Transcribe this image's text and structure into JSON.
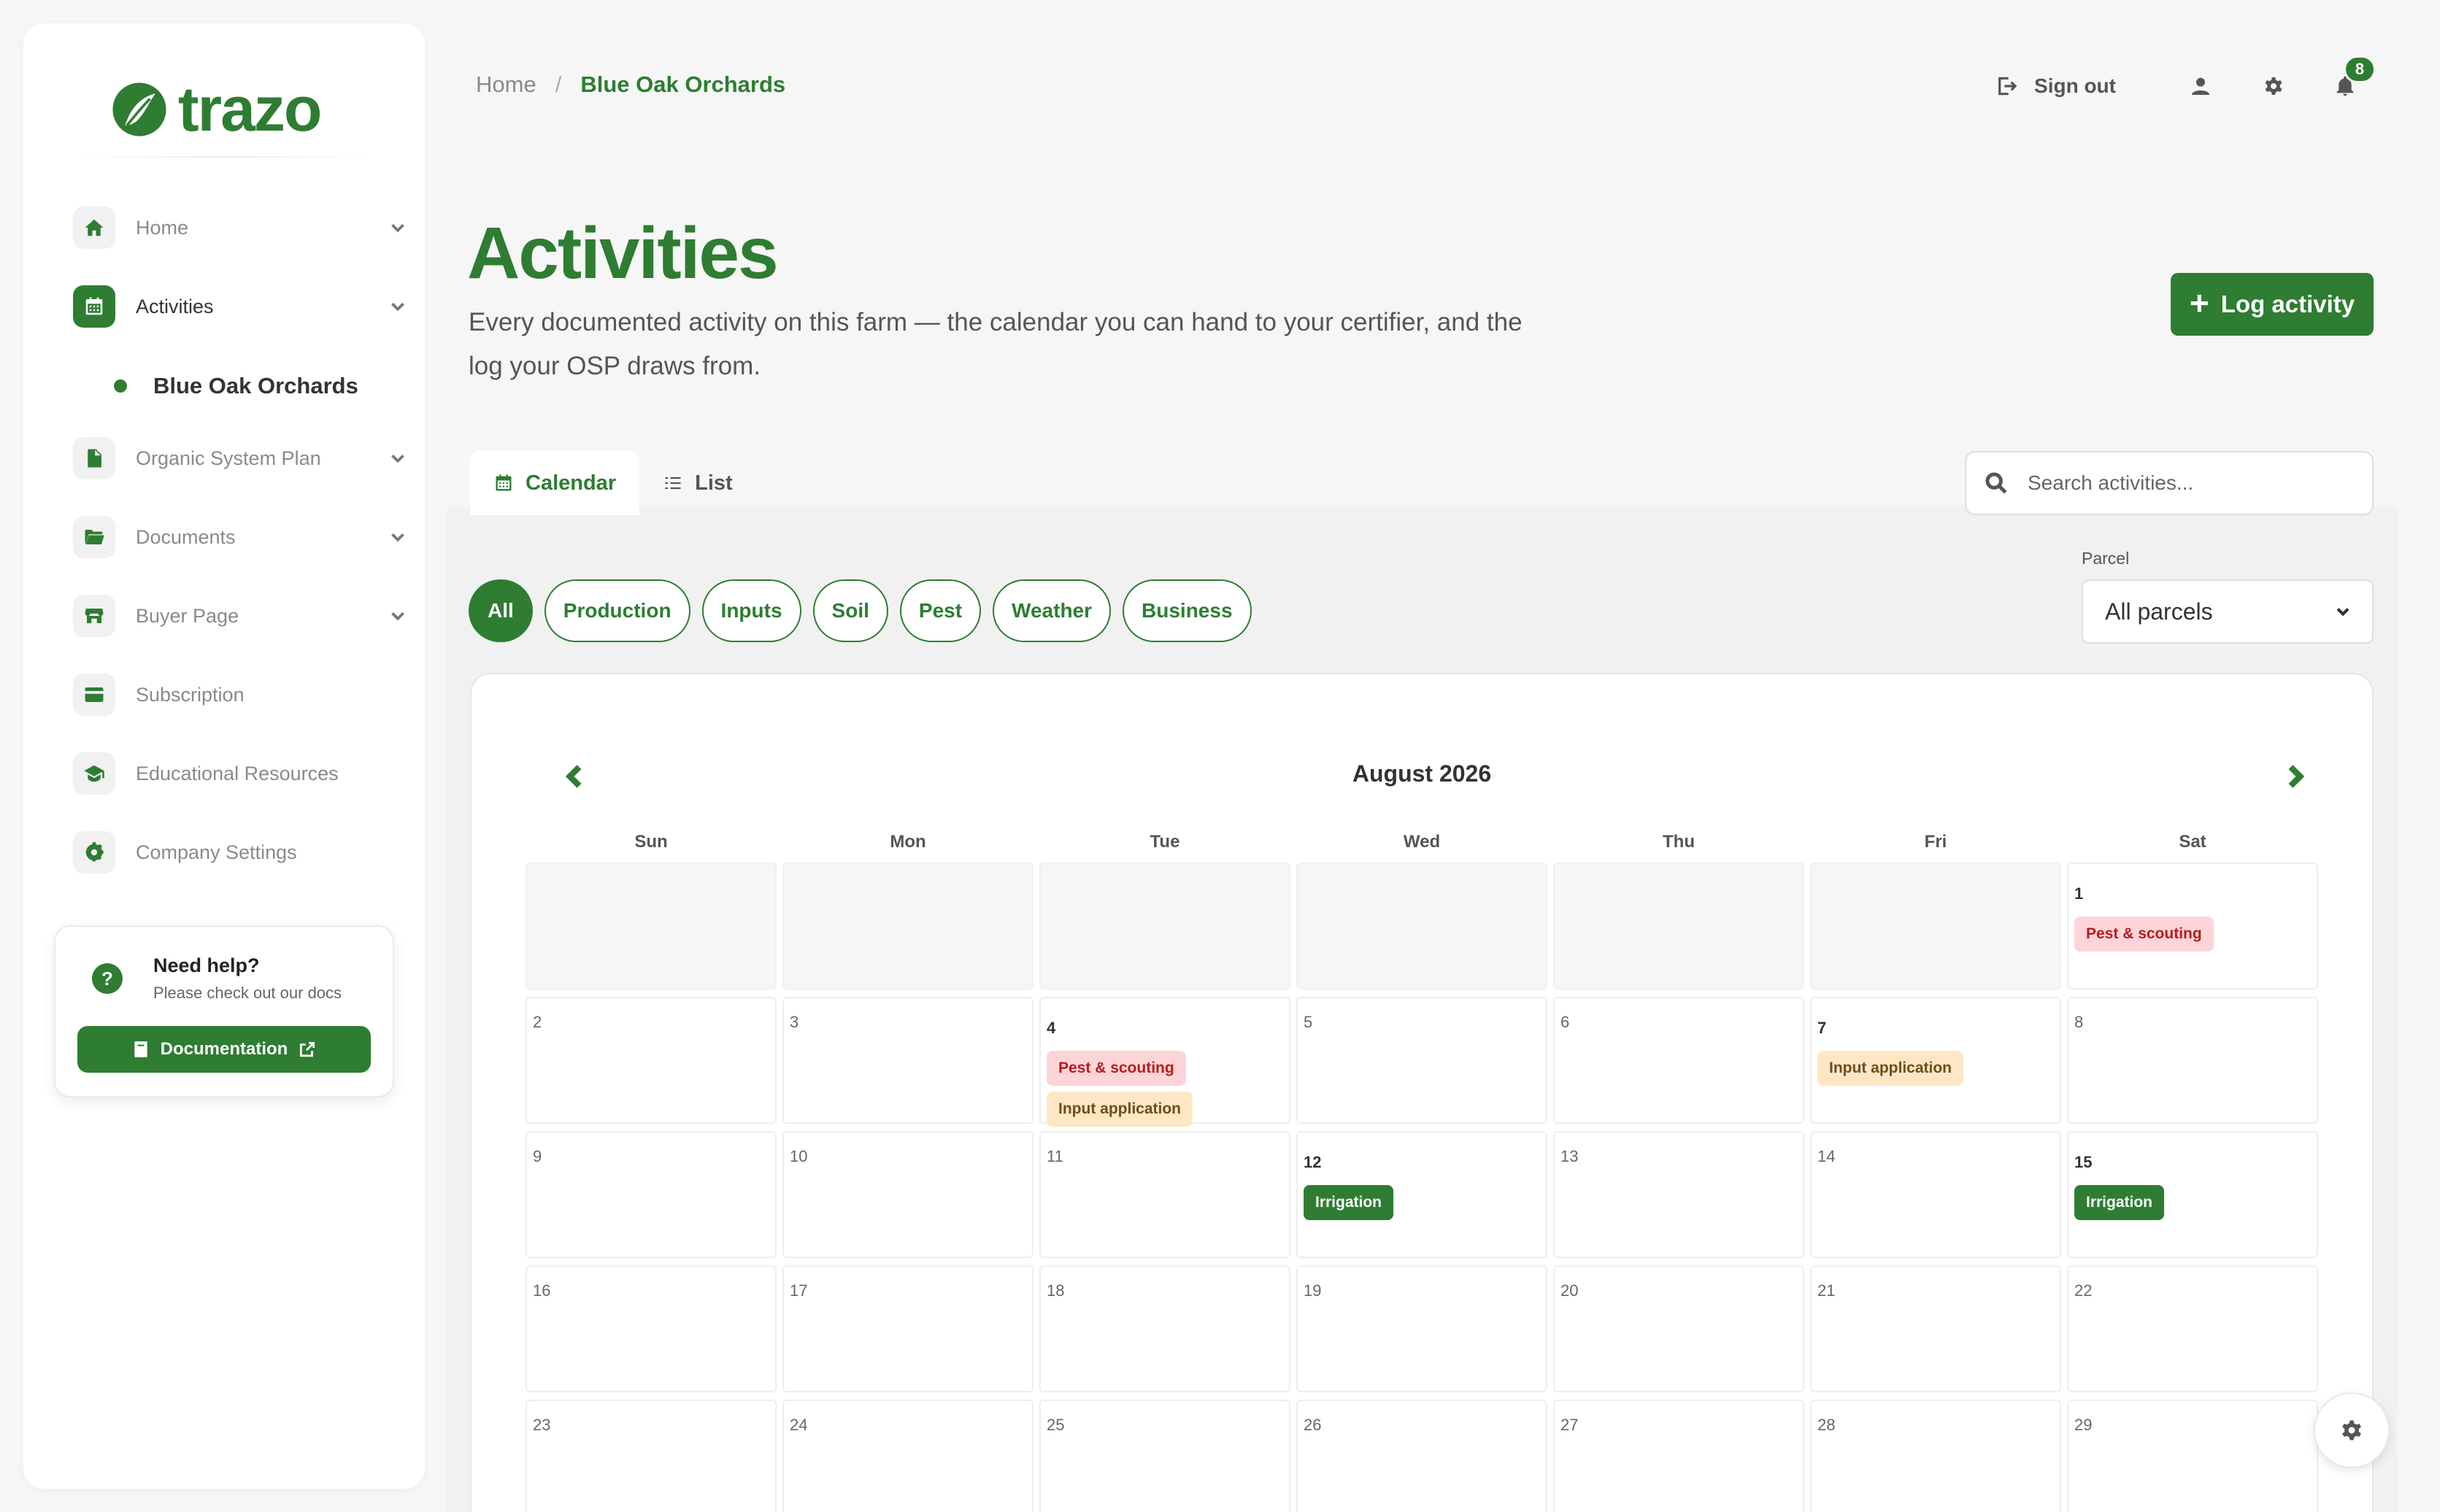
{
  "app": {
    "logo_text": "trazo",
    "brand_color": "#2e7d32"
  },
  "sidebar": {
    "items": [
      {
        "label": "Home",
        "icon": "home-icon",
        "active": false,
        "has_chevron": true
      },
      {
        "label": "Activities",
        "icon": "calendar-icon",
        "active": true,
        "has_chevron": true
      },
      {
        "label": "Organic System Plan",
        "icon": "document-icon",
        "active": false,
        "has_chevron": true
      },
      {
        "label": "Documents",
        "icon": "folder-icon",
        "active": false,
        "has_chevron": true
      },
      {
        "label": "Buyer Page",
        "icon": "store-icon",
        "active": false,
        "has_chevron": true
      },
      {
        "label": "Subscription",
        "icon": "credit-card-icon",
        "active": false,
        "has_chevron": false
      },
      {
        "label": "Educational Resources",
        "icon": "graduation-cap-icon",
        "active": false,
        "has_chevron": false
      },
      {
        "label": "Company Settings",
        "icon": "gear-icon",
        "active": false,
        "has_chevron": false
      }
    ],
    "sub_item": {
      "label": "Blue Oak Orchards"
    },
    "help": {
      "title": "Need help?",
      "subtitle": "Please check out our docs",
      "button_label": "Documentation"
    }
  },
  "header": {
    "breadcrumb": {
      "home": "Home",
      "separator": "/",
      "current": "Blue Oak Orchards"
    },
    "sign_out_label": "Sign out",
    "notification_count": "8"
  },
  "page": {
    "title": "Activities",
    "description": "Every documented activity on this farm — the calendar you can hand to your certifier, and the log your OSP draws from.",
    "log_button_label": "Log activity"
  },
  "views": {
    "tabs": [
      {
        "label": "Calendar",
        "icon": "calendar-icon",
        "active": true
      },
      {
        "label": "List",
        "icon": "list-icon",
        "active": false
      }
    ],
    "search_placeholder": "Search activities..."
  },
  "filters": {
    "chips": [
      {
        "label": "All",
        "active": true
      },
      {
        "label": "Production",
        "active": false
      },
      {
        "label": "Inputs",
        "active": false
      },
      {
        "label": "Soil",
        "active": false
      },
      {
        "label": "Pest",
        "active": false
      },
      {
        "label": "Weather",
        "active": false
      },
      {
        "label": "Business",
        "active": false
      }
    ],
    "parcel_label": "Parcel",
    "parcel_value": "All parcels"
  },
  "calendar": {
    "month_label": "August 2026",
    "weekdays": [
      "Sun",
      "Mon",
      "Tue",
      "Wed",
      "Thu",
      "Fri",
      "Sat"
    ],
    "leading_blank_days": 6,
    "days": [
      {
        "day": "1",
        "events": [
          "Pest & scouting"
        ]
      },
      {
        "day": "2",
        "events": []
      },
      {
        "day": "3",
        "events": []
      },
      {
        "day": "4",
        "events": [
          "Pest & scouting",
          "Input application"
        ]
      },
      {
        "day": "5",
        "events": []
      },
      {
        "day": "6",
        "events": []
      },
      {
        "day": "7",
        "events": [
          "Input application"
        ]
      },
      {
        "day": "8",
        "events": []
      },
      {
        "day": "9",
        "events": []
      },
      {
        "day": "10",
        "events": []
      },
      {
        "day": "11",
        "events": []
      },
      {
        "day": "12",
        "events": [
          "Irrigation"
        ]
      },
      {
        "day": "13",
        "events": []
      },
      {
        "day": "14",
        "events": []
      },
      {
        "day": "15",
        "events": [
          "Irrigation"
        ]
      },
      {
        "day": "16",
        "events": []
      },
      {
        "day": "17",
        "events": []
      },
      {
        "day": "18",
        "events": []
      },
      {
        "day": "19",
        "events": []
      },
      {
        "day": "20",
        "events": []
      },
      {
        "day": "21",
        "events": []
      },
      {
        "day": "22",
        "events": []
      },
      {
        "day": "23",
        "events": []
      },
      {
        "day": "24",
        "events": []
      },
      {
        "day": "25",
        "events": []
      },
      {
        "day": "26",
        "events": []
      },
      {
        "day": "27",
        "events": []
      },
      {
        "day": "28",
        "events": []
      },
      {
        "day": "29",
        "events": []
      }
    ],
    "event_styles": {
      "Pest & scouting": {
        "bg": "#fdd5d9",
        "fg": "#b71c1c"
      },
      "Input application": {
        "bg": "#fde7c4",
        "fg": "#6d4c1f"
      },
      "Irrigation": {
        "bg": "#2e7d32",
        "fg": "#ffffff"
      }
    }
  }
}
